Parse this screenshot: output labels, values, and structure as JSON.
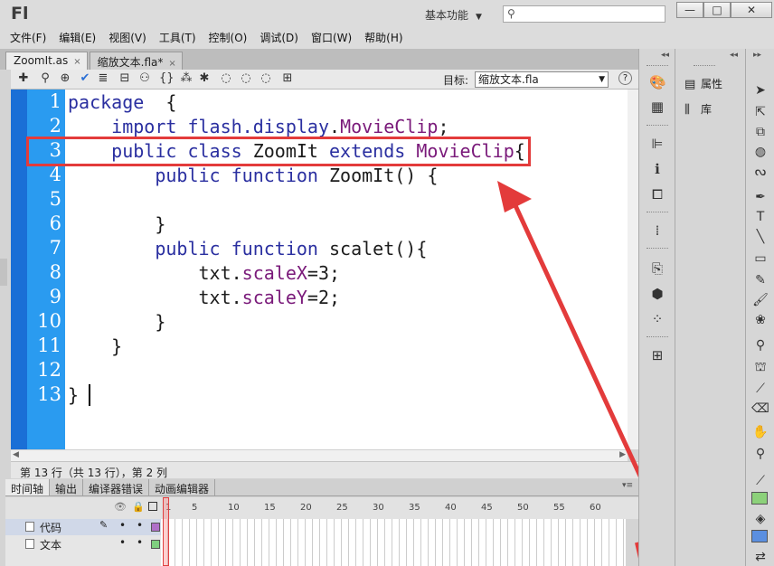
{
  "app": {
    "logo": "Fl",
    "workspace": "基本功能",
    "search_placeholder": ""
  },
  "window_buttons": {
    "minimize": "—",
    "maximize": "□",
    "close": "✕"
  },
  "menu": [
    "文件(F)",
    "编辑(E)",
    "视图(V)",
    "工具(T)",
    "控制(O)",
    "调试(D)",
    "窗口(W)",
    "帮助(H)"
  ],
  "doc_tabs": [
    {
      "label": "ZoomIt.as",
      "close": "×"
    },
    {
      "label": "缩放文本.fla*",
      "close": "×"
    }
  ],
  "toolbar": {
    "target_label": "目标:",
    "target_value": "缩放文本.fla",
    "help": "?"
  },
  "code_lines": [
    {
      "num": "1",
      "text": "package  {"
    },
    {
      "num": "2",
      "text": "    import flash.display.MovieClip;"
    },
    {
      "num": "3",
      "text": "    public class ZoomIt extends MovieClip{"
    },
    {
      "num": "4",
      "text": "        public function ZoomIt() {"
    },
    {
      "num": "5",
      "text": ""
    },
    {
      "num": "6",
      "text": "        }"
    },
    {
      "num": "7",
      "text": "        public function scalet(){"
    },
    {
      "num": "8",
      "text": "            txt.scaleX=3;"
    },
    {
      "num": "9",
      "text": "            txt.scaleY=2;"
    },
    {
      "num": "10",
      "text": "        }"
    },
    {
      "num": "11",
      "text": "    }"
    },
    {
      "num": "12",
      "text": ""
    },
    {
      "num": "13",
      "text": "}"
    }
  ],
  "status": "第 13 行（共 13 行），第 2 列",
  "timeline": {
    "tabs": [
      "时间轴",
      "输出",
      "编译器错误",
      "动画编辑器"
    ],
    "frame_numbers": [
      "1",
      "5",
      "10",
      "15",
      "20",
      "25",
      "30",
      "35",
      "40",
      "45",
      "50",
      "55",
      "60"
    ],
    "layers": [
      {
        "name": "代码",
        "color": "#b070c8",
        "selected": true
      },
      {
        "name": "文本",
        "color": "#80d080",
        "selected": false
      }
    ]
  },
  "panels": {
    "properties": "属性",
    "library": "库"
  },
  "colors": {
    "highlight": "#e33b3b",
    "gutter": "#2a9bf0",
    "stroke_swatch": "#8cd17a",
    "fill_swatch": "#5b8fe0"
  }
}
